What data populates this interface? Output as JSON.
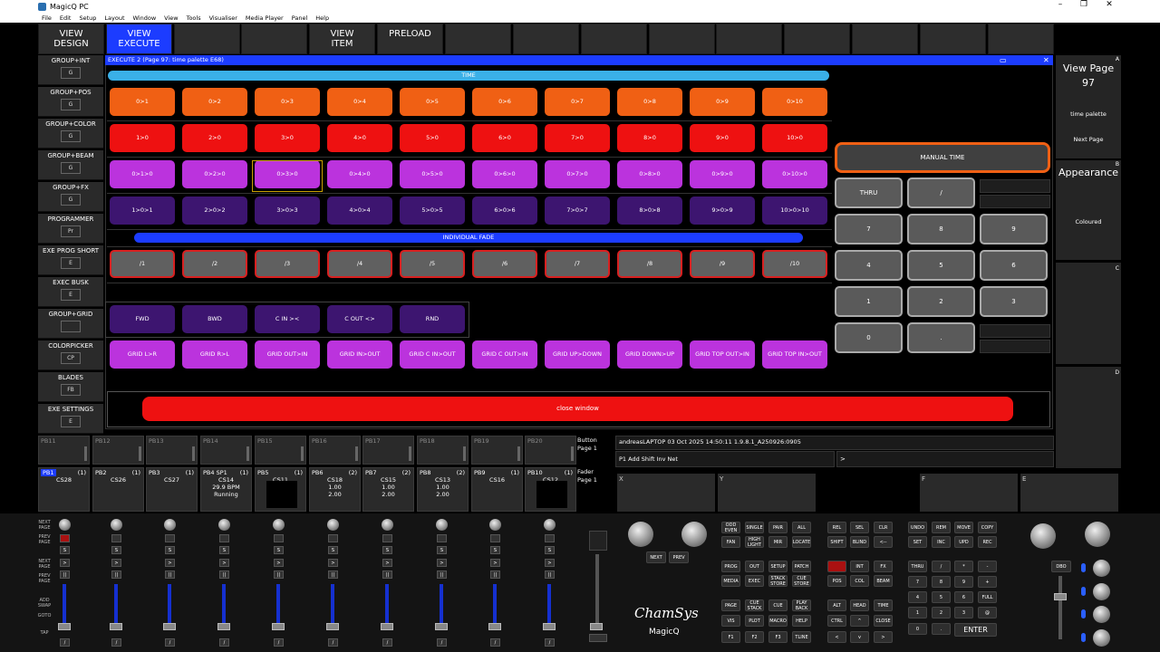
{
  "window": {
    "title": "MagicQ PC",
    "min": "–",
    "max": "❐",
    "close": "✕"
  },
  "menu": [
    "File",
    "Edit",
    "Setup",
    "Layout",
    "Window",
    "View",
    "Tools",
    "Visualiser",
    "Media Player",
    "Panel",
    "Help"
  ],
  "top_buttons": [
    {
      "label": "VIEW\nDESIGN",
      "selected": false
    },
    {
      "label": "VIEW\nEXECUTE",
      "selected": true
    },
    {
      "label": "",
      "selected": false
    },
    {
      "label": "",
      "selected": false
    },
    {
      "label": "VIEW\nITEM",
      "selected": false
    },
    {
      "label": "PRELOAD",
      "selected": false
    },
    {
      "label": "",
      "selected": false
    },
    {
      "label": "",
      "selected": false
    },
    {
      "label": "",
      "selected": false
    },
    {
      "label": "",
      "selected": false
    },
    {
      "label": "",
      "selected": false
    },
    {
      "label": "",
      "selected": false
    },
    {
      "label": "",
      "selected": false
    },
    {
      "label": "",
      "selected": false
    },
    {
      "label": "",
      "selected": false
    }
  ],
  "left_buttons": [
    {
      "label": "GROUP+INT",
      "sub": "G"
    },
    {
      "label": "GROUP+POS",
      "sub": "G"
    },
    {
      "label": "GROUP+COLOR",
      "sub": "G"
    },
    {
      "label": "GROUP+BEAM",
      "sub": "G"
    },
    {
      "label": "GROUP+FX",
      "sub": "G"
    },
    {
      "label": "PROGRAMMER",
      "sub": "Pr"
    },
    {
      "label": "EXE PROG SHORT",
      "sub": "E"
    },
    {
      "label": "EXEC BUSK",
      "sub": "E"
    },
    {
      "label": "GROUP+GRID",
      "sub": ""
    },
    {
      "label": "COLORPICKER",
      "sub": "CP"
    },
    {
      "label": "BLADES",
      "sub": "FB"
    },
    {
      "label": "EXE SETTINGS",
      "sub": "E"
    }
  ],
  "exec_window": {
    "title": "EXECUTE 2 (Page 97: time palette E68)",
    "restore": "▭",
    "close": "✕",
    "time_bar": "TIME",
    "row_time_on": [
      "0>1",
      "0>2",
      "0>3",
      "0>4",
      "0>5",
      "0>6",
      "0>7",
      "0>8",
      "0>9",
      "0>10"
    ],
    "row_time_off": [
      "1>0",
      "2>0",
      "3>0",
      "4>0",
      "5>0",
      "6>0",
      "7>0",
      "8>0",
      "9>0",
      "10>0"
    ],
    "row_time_on_off": [
      "0>1>0",
      "0>2>0",
      "0>3>0",
      "0>4>0",
      "0>5>0",
      "0>6>0",
      "0>7>0",
      "0>8>0",
      "0>9>0",
      "0>10>0"
    ],
    "row_time_off_on": [
      "1>0>1",
      "2>0>2",
      "3>0>3",
      "4>0>4",
      "5>0>5",
      "6>0>6",
      "7>0>7",
      "8>0>8",
      "9>0>9",
      "10>0>10"
    ],
    "fade_bar": "INDIVIDUAL FADE",
    "row_fade": [
      "/1",
      "/2",
      "/3",
      "/4",
      "/5",
      "/6",
      "/7",
      "/8",
      "/9",
      "/10"
    ],
    "row_order": [
      "FWD",
      "BWD",
      "C IN ><",
      "C OUT <>",
      "RND"
    ],
    "row_grid": [
      "GRID L>R",
      "GRID R>L",
      "GRID OUT>IN",
      "GRID IN>OUT",
      "GRID C IN>OUT",
      "GRID C OUT>IN",
      "GRID UP>DOWN",
      "GRID DOWN>UP",
      "GRID TOP OUT>IN",
      "GRID TOP IN>OUT"
    ],
    "close_window": "close window"
  },
  "manual_time": {
    "title": "MANUAL TIME",
    "keys": [
      [
        "THRU",
        "/",
        ""
      ],
      [
        "7",
        "8",
        "9"
      ],
      [
        "4",
        "5",
        "6"
      ],
      [
        "1",
        "2",
        "3"
      ],
      [
        "0",
        ".",
        ""
      ]
    ]
  },
  "right_panel": {
    "view_page": "View Page",
    "page_num": "97",
    "palette": "time palette",
    "next_page": "Next Page",
    "appearance": "Appearance",
    "coloured": "Coloured",
    "letters": [
      "A",
      "B",
      "C",
      "D"
    ]
  },
  "playback_buttons": [
    "PB11",
    "PB12",
    "PB13",
    "PB14",
    "PB15",
    "PB16",
    "PB17",
    "PB18",
    "PB19",
    "PB20"
  ],
  "button_page": "Button\nPage 1",
  "fader_page": "Fader\nPage 1",
  "faders": [
    {
      "pb": "PB1",
      "n": "(1)",
      "cue": "CS28",
      "l1": "",
      "l2": "",
      "sel": true
    },
    {
      "pb": "PB2",
      "n": "(1)",
      "cue": "CS26",
      "l1": "",
      "l2": "",
      "sel": false
    },
    {
      "pb": "PB3",
      "n": "(1)",
      "cue": "CS27",
      "l1": "",
      "l2": "",
      "sel": false
    },
    {
      "pb": "PB4 SP1",
      "n": "(1)",
      "cue": "CS14",
      "l1": "29.9 BPM",
      "l2": "Running",
      "sel": false
    },
    {
      "pb": "PB5",
      "n": "(1)",
      "cue": "CS11",
      "l1": "",
      "l2": "",
      "sel": false
    },
    {
      "pb": "PB6",
      "n": "(2)",
      "cue": "CS18",
      "l1": "1.00",
      "l2": "2.00",
      "sel": false
    },
    {
      "pb": "PB7",
      "n": "(2)",
      "cue": "CS15",
      "l1": "1.00",
      "l2": "2.00",
      "sel": false
    },
    {
      "pb": "PB8",
      "n": "(2)",
      "cue": "CS13",
      "l1": "1.00",
      "l2": "2.00",
      "sel": false
    },
    {
      "pb": "PB9",
      "n": "(1)",
      "cue": "CS16",
      "l1": "",
      "l2": "",
      "sel": false
    },
    {
      "pb": "PB10",
      "n": "(1)",
      "cue": "CS12",
      "l1": "",
      "l2": "",
      "sel": false
    }
  ],
  "status": {
    "line1": "andreasLAPTOP 03 Oct 2025 14:50:11 1.9.8.1_A250926:0905",
    "line2": "P1  Add Shift Inv Net",
    "prompt": ">"
  },
  "encoders": [
    {
      "label": "X"
    },
    {
      "label": "Y"
    },
    {
      "label": ""
    },
    {
      "label": "F"
    },
    {
      "label": "E"
    }
  ],
  "console": {
    "side_labels": [
      "NEXT\nPAGE",
      "PREV\nPAGE",
      "NEXT\nPAGE",
      "PREV\nPAGE",
      "ADD\nSWAP",
      "GOTO",
      "TAP"
    ],
    "fader_keys": [
      "S",
      ">",
      "||",
      "/"
    ],
    "nav_keys": [
      "NEXT",
      "PREV"
    ],
    "brand": "ChamSys",
    "brand2": "MagicQ",
    "keys_a": [
      [
        "ODD\nEVEN",
        "SINGLE",
        "PAIR",
        "ALL"
      ],
      [
        "FAN",
        "HIGH\nLIGHT",
        "MIR",
        "LOCATE"
      ],
      [
        "PROG",
        "OUT",
        "SETUP",
        "PATCH"
      ],
      [
        "MEDIA",
        "EXEC",
        "STACK\nSTORE",
        "CUE\nSTORE"
      ],
      [
        "PAGE",
        "CUE\nSTACK",
        "CUE",
        "PLAY\nBACK"
      ],
      [
        "VIS",
        "PLOT",
        "MACRO",
        "HELP"
      ],
      [
        "F1",
        "F2",
        "F3",
        "TLINE"
      ]
    ],
    "keys_b": [
      [
        "REL",
        "SEL",
        "CLR"
      ],
      [
        "SHIFT",
        "BLIND",
        "<--"
      ],
      [
        "",
        "INT",
        "FX"
      ],
      [
        "POS",
        "COL",
        "BEAM"
      ],
      [
        "ALT",
        "HEAD",
        "TIME"
      ],
      [
        "CTRL",
        "^",
        "CLOSE"
      ],
      [
        "<",
        "v",
        ">"
      ]
    ],
    "keys_c": [
      [
        "UNDO",
        "REM",
        "MOVE",
        "COPY"
      ],
      [
        "SET",
        "INC",
        "UPD",
        "REC"
      ],
      [
        "THRU",
        "/",
        "*",
        "-"
      ],
      [
        "7",
        "8",
        "9",
        "+"
      ],
      [
        "4",
        "5",
        "6",
        "FULL"
      ],
      [
        "1",
        "2",
        "3",
        "@"
      ],
      [
        "0",
        ".",
        "ENTER",
        ""
      ]
    ],
    "dbo": "DBO"
  }
}
